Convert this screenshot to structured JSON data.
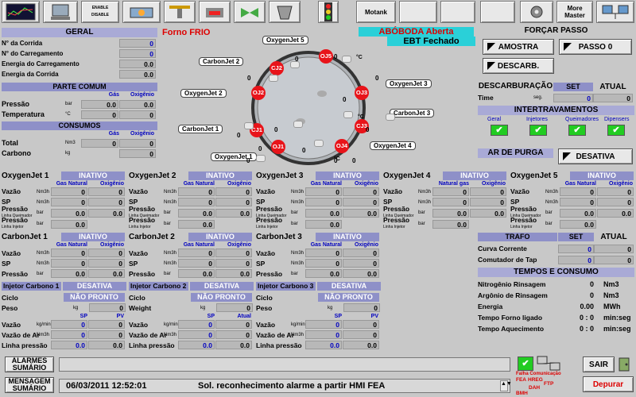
{
  "toolbar": {
    "motank": "Motank",
    "more_master": "More Master",
    "enable1": "ENABLE",
    "disable1": "DISABLE"
  },
  "geral": {
    "title": "GERAL",
    "rows": [
      {
        "label": "N° da Corrida",
        "value": "0"
      },
      {
        "label": "N° do Carregamento",
        "value": "0"
      },
      {
        "label": "Energia do Carregamento",
        "value": "0.0"
      },
      {
        "label": "Energia da Corrida",
        "value": "0.0"
      }
    ]
  },
  "parte_comum": {
    "title": "PARTE COMUM",
    "col1": "Gás",
    "col2": "Oxigênio",
    "rows": [
      {
        "label": "Pressão",
        "unit": "bar",
        "v1": "0.0",
        "v2": "0.0"
      },
      {
        "label": "Temperatura",
        "unit": "°C",
        "v1": "0",
        "v2": "0"
      }
    ]
  },
  "consumos": {
    "title": "CONSUMOS",
    "col1": "Gás",
    "col2": "Oxigênio",
    "rows": [
      {
        "label": "Total",
        "unit": "Nm3",
        "v1": "0",
        "v2": "0"
      },
      {
        "label": "Carbono",
        "unit": "kg",
        "v1": "",
        "v2": "0"
      }
    ]
  },
  "furnace": {
    "forno": "Forno FRIO",
    "aboboda": "ABÓBODA Aberta",
    "ebt": "EBT Fechado",
    "unit": "°C",
    "labels": [
      "OxygenJet 5",
      "CarbonJet 2",
      "OxygenJet 3",
      "OxygenJet 2",
      "CarbonJet 3",
      "CarbonJet 1",
      "OxygenJet 4",
      "OxygenJet 1"
    ],
    "circles": [
      "OJ5",
      "CJ2",
      "OJ2",
      "OJ3",
      "CJ3",
      "CJ1",
      "OJ1",
      "OJ4"
    ],
    "zeros": "0"
  },
  "forcar": {
    "title": "FORÇAR PASSO",
    "amostra": "AMOSTRA",
    "passo": "PASSO 0",
    "descarb": "DESCARB."
  },
  "descarb": {
    "title": "DESCARBURAÇÃO",
    "set": "SET",
    "atual": "ATUAL",
    "time": "Time",
    "unit": "seg.",
    "v1": "0",
    "v2": "0"
  },
  "intert": {
    "title": "INTERTRAVAMENTOS",
    "items": [
      "Geral",
      "Injetores",
      "Queimadores",
      "Dipensers"
    ],
    "check": "✔"
  },
  "purga": {
    "title": "AR DE PURGA",
    "btn": "DESATIVA"
  },
  "ojs": [
    {
      "name": "OxygenJet 1",
      "status": "INATIVO",
      "c1": "Gas Natural",
      "c2": "Oxigênio"
    },
    {
      "name": "OxygenJet 2",
      "status": "INATIVO",
      "c1": "Gas Natural",
      "c2": "Oxigênio"
    },
    {
      "name": "OxygenJet 3",
      "status": "INATIVO",
      "c1": "Gas Natural",
      "c2": "Oxigênio"
    },
    {
      "name": "OxygenJet 4",
      "status": "INATIVO",
      "c1": "Natural gas",
      "c2": "Oxigênio"
    },
    {
      "name": "OxygenJet 5",
      "status": "INATIVO",
      "c1": "Gas Natural",
      "c2": "Oxigênio"
    }
  ],
  "oj_rows": {
    "vazao": "Vazão",
    "sp": "SP",
    "pq": "Pressão",
    "pq_sub": "Linha Queimador",
    "pi": "Pressão",
    "pi_sub": "Linha Injetor",
    "nm3h": "Nm3h",
    "bar": "bar",
    "z": "0",
    "zz": "0.0"
  },
  "cjs": [
    {
      "name": "CarbonJet 1",
      "status": "INATIVO",
      "c1": "Gas Natural",
      "c2": "Oxigênio"
    },
    {
      "name": "CarbonJet 2",
      "status": "INATIVO",
      "c1": "Gas Natural",
      "c2": "Oxigênio"
    },
    {
      "name": "CarbonJet 3",
      "status": "INATIVO",
      "c1": "Gas Natural",
      "c2": "Oxigênio"
    }
  ],
  "cj_rows": {
    "vazao": "Vazão",
    "sp": "SP",
    "p": "Pressão"
  },
  "injs": [
    {
      "name": "Injetor Carbono 1",
      "status": "DESATIVA",
      "ciclo": "Ciclo",
      "np": "NÃO PRONTO",
      "peso": "Peso",
      "sp": "SP",
      "pv": "PV"
    },
    {
      "name": "Injetor Carbono 2",
      "status": "DESATIVA",
      "ciclo": "Ciclo",
      "np": "NÃO PRONTO",
      "peso": "Weight",
      "sp": "SP",
      "pv": "Atual"
    },
    {
      "name": "Injetor Carbono 3",
      "status": "DESATIVA",
      "ciclo": "Ciclo",
      "np": "NÃO PRONTO",
      "peso": "Peso",
      "sp": "SP",
      "pv": "PV"
    }
  ],
  "inj_rows": {
    "vazao": "Vazão",
    "vazao_ar": "Vazão de Ar",
    "linha": "Linha pressão",
    "kg": "kg",
    "kgmin": "kg/min",
    "nm3h": "Nm3h",
    "bar": "bar"
  },
  "trafo": {
    "title": "TRAFO",
    "set": "SET",
    "atual": "ATUAL",
    "r1": "Curva Corrente",
    "r2": "Comutador de Tap",
    "v": "0"
  },
  "tempos": {
    "title": "TEMPOS E CONSUMO",
    "rows": [
      {
        "label": "Nitrogênio Rinsagem",
        "value": "0",
        "unit": "Nm3"
      },
      {
        "label": "Argônio de Rinsagem",
        "value": "0",
        "unit": "Nm3"
      },
      {
        "label": "Energia",
        "value": "0.00",
        "unit": "MWh"
      },
      {
        "label": "Tempo Forno ligado",
        "value": "0 : 0",
        "unit": "min:seg"
      },
      {
        "label": "Tempo Aquecimento",
        "value": "0 : 0",
        "unit": "min:seg"
      }
    ]
  },
  "bottom": {
    "alarmes": "ALARMES SUMÁRIO",
    "mensagem": "MENSAGEM SUMÁRIO",
    "datetime": "06/03/2011 12:52:01",
    "message": "Sol. reconhecimento alarme a partir HMI FEA",
    "falha": "Falha Comunicação",
    "fea": "FEA",
    "hreg": "HREG",
    "ftp": "FTP",
    "dah": "DAH",
    "bmh": "BMH",
    "sair": "SAIR",
    "depurar": "Depurar"
  }
}
